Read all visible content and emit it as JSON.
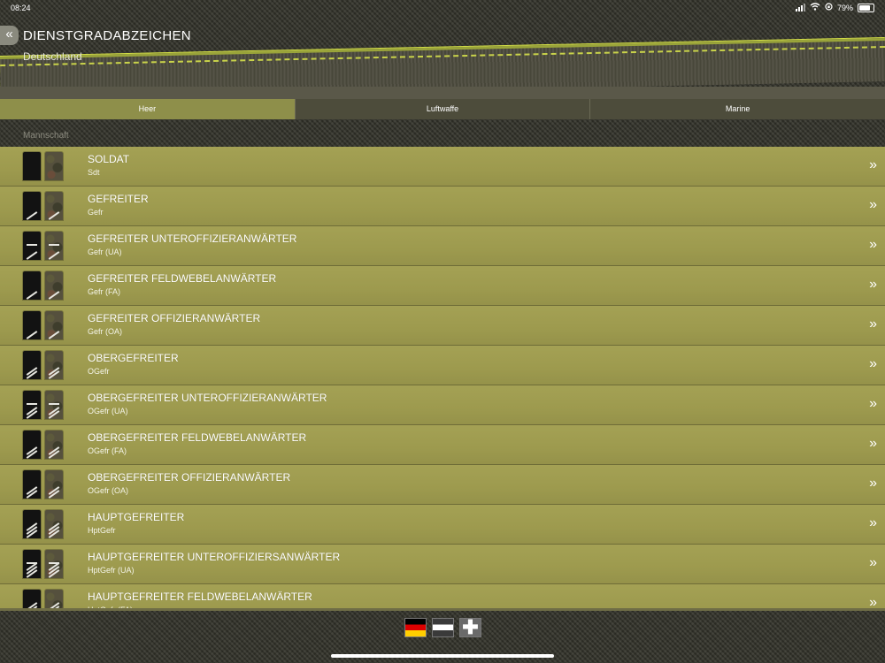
{
  "status_bar": {
    "time": "08:24",
    "battery": "79%"
  },
  "header": {
    "title": "DIENSTGRADABZEICHEN",
    "subtitle": "Deutschland",
    "back_icon": "double-chevron-left-icon"
  },
  "tabs": [
    {
      "label": "Heer",
      "active": true
    },
    {
      "label": "Luftwaffe",
      "active": false
    },
    {
      "label": "Marine",
      "active": false
    }
  ],
  "section": {
    "label": "Mannschaft"
  },
  "ranks": [
    {
      "title": "SOLDAT",
      "abbr": "Sdt"
    },
    {
      "title": "GEFREITER",
      "abbr": "Gefr"
    },
    {
      "title": "GEFREITER UNTEROFFIZIERANWÄRTER",
      "abbr": "Gefr (UA)"
    },
    {
      "title": "GEFREITER FELDWEBELANWÄRTER",
      "abbr": "Gefr (FA)"
    },
    {
      "title": "GEFREITER OFFIZIERANWÄRTER",
      "abbr": "Gefr (OA)"
    },
    {
      "title": "OBERGEFREITER",
      "abbr": "OGefr"
    },
    {
      "title": "OBERGEFREITER UNTEROFFIZIERANWÄRTER",
      "abbr": "OGefr (UA)"
    },
    {
      "title": "OBERGEFREITER FELDWEBELANWÄRTER",
      "abbr": "OGefr (FA)"
    },
    {
      "title": "OBERGEFREITER OFFIZIERANWÄRTER",
      "abbr": "OGefr (OA)"
    },
    {
      "title": "HAUPTGEFREITER",
      "abbr": "HptGefr"
    },
    {
      "title": "HAUPTGEFREITER UNTEROFFIZIERSANWÄRTER",
      "abbr": "HptGefr (UA)"
    },
    {
      "title": "HAUPTGEFREITER FELDWEBELANWÄRTER",
      "abbr": "HptGefr (FA)"
    }
  ],
  "chevron_glyph": "»",
  "footer": {
    "flags": [
      {
        "name": "germany-flag-icon"
      },
      {
        "name": "austria-flag-icon"
      },
      {
        "name": "switzerland-flag-icon",
        "glyph": "✚"
      }
    ]
  }
}
